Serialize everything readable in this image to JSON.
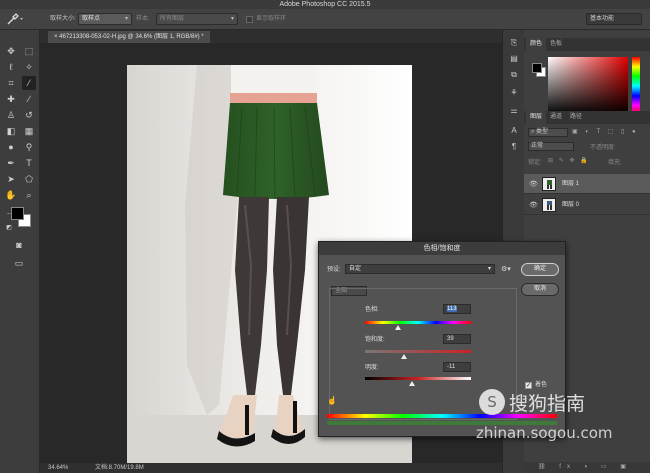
{
  "app": {
    "title": "Adobe Photoshop CC 2015.5"
  },
  "options_bar": {
    "sample_size_label": "取样大小:",
    "sample_size_value": "取样点",
    "sample_label": "样本:",
    "sample_value": "所有图层",
    "show_ring_label": "显示取样环",
    "workspace": "基本功能"
  },
  "document": {
    "tab_label": "467213308-053-02-H.jpg @ 34.6% (图层 1, RGB/8#) *"
  },
  "status": {
    "zoom": "34.64%",
    "doc_size": "文档:8.70M/19.8M"
  },
  "panels": {
    "color_tabs": [
      "颜色",
      "色板"
    ],
    "layer_tabs": [
      "图层",
      "通道",
      "路径"
    ],
    "filter_kind": "类型",
    "blend_mode": "正常",
    "opacity_label": "不透明度:",
    "lock_label": "锁定:",
    "fill_label": "填充:",
    "layers": [
      {
        "name": "图层 1",
        "selected": true
      },
      {
        "name": "图层 0",
        "selected": false
      }
    ]
  },
  "dialog": {
    "title": "色相/饱和度",
    "preset_label": "预设:",
    "preset_value": "自定",
    "channel_value": "全图",
    "hue_label": "色相:",
    "hue_value": "113",
    "saturation_label": "饱和度:",
    "saturation_value": "39",
    "lightness_label": "明度:",
    "lightness_value": "-11",
    "ok_label": "确定",
    "cancel_label": "取消",
    "colorize_label": "着色",
    "colorize_checked": true,
    "preview_label": "预览",
    "slider_levels": {
      "hue": 0.31,
      "saturation": 0.37,
      "lightness": 0.44
    }
  },
  "watermark": {
    "logo_text": "搜狗指南",
    "url": "zhinan.sogou.com"
  },
  "colors": {
    "skirt_green": "#2e5d2a",
    "waistband_pink": "#e6a393",
    "accent_red": "#e00000"
  }
}
